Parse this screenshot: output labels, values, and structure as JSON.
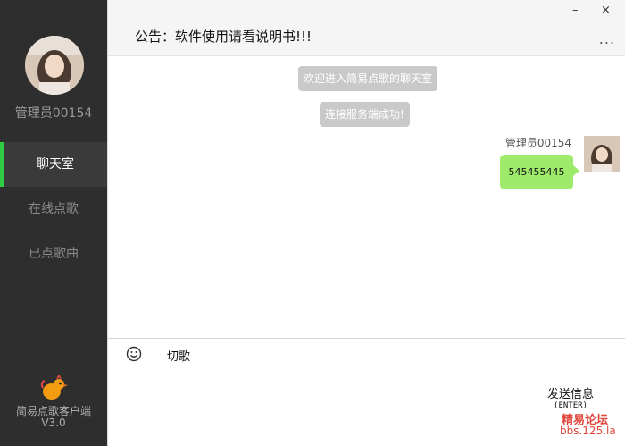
{
  "sidebar": {
    "username": "管理员00154",
    "nav": [
      {
        "label": "聊天室",
        "active": true
      },
      {
        "label": "在线点歌",
        "active": false
      },
      {
        "label": "已点歌曲",
        "active": false
      }
    ],
    "client_name": "简易点歌客户端",
    "client_version": "V3.0"
  },
  "header": {
    "notice": "公告：软件使用请看说明书!!!",
    "minimize_label": "–",
    "close_label": "×",
    "more_label": "..."
  },
  "chat": {
    "system_messages": [
      "欢迎进入简易点歌的聊天室",
      "连接服务端成功!"
    ],
    "sender": "管理员00154",
    "message": "545455445"
  },
  "input": {
    "text": "切歌",
    "send_label": "发送信息",
    "send_hint": "(ENTER)"
  },
  "watermark": {
    "line1": "精易论坛",
    "line2": "bbs.125.la"
  },
  "colors": {
    "sidebar_bg": "#2e2e2e",
    "active_accent": "#2ecc40",
    "bubble": "#9eea6a",
    "system_msg_bg": "#c9c9c9",
    "watermark": "#e0453a"
  }
}
